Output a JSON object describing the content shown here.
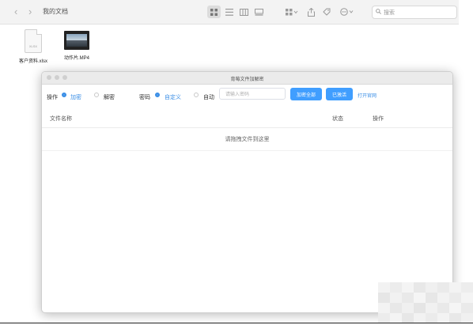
{
  "finder": {
    "title": "我的文档",
    "back_glyph": "‹",
    "forward_glyph": "›",
    "search_placeholder": "搜索",
    "toolbar_icons": [
      "grid-view-icon",
      "list-view-icon",
      "column-view-icon",
      "gallery-view-icon",
      "group-icon",
      "share-icon",
      "tag-icon",
      "more-actions-icon"
    ]
  },
  "files": [
    {
      "name": "客户资料.xlsx",
      "ext": "XLSX",
      "type": "spreadsheet"
    },
    {
      "name": "动作片.MP4",
      "type": "video"
    }
  ],
  "app": {
    "title": "育莓文件加解密",
    "operation_label": "操作",
    "encrypt_label": "加密",
    "decrypt_label": "解密",
    "operation_selected": "加密",
    "password_label": "密码",
    "custom_label": "自定义",
    "auto_label": "自动",
    "password_mode_selected": "自定义",
    "password_placeholder": "请输入密码",
    "encrypt_all_button": "加密全部",
    "activated_button": "已激活",
    "open_website_link": "打开官网",
    "table": {
      "columns": {
        "name": "文件名称",
        "status": "状态",
        "action": "操作"
      },
      "rows": []
    },
    "drop_hint": "请拖拽文件到这里"
  },
  "colors": {
    "accent": "#409eff",
    "radio_checked": "#3a8ee6"
  }
}
